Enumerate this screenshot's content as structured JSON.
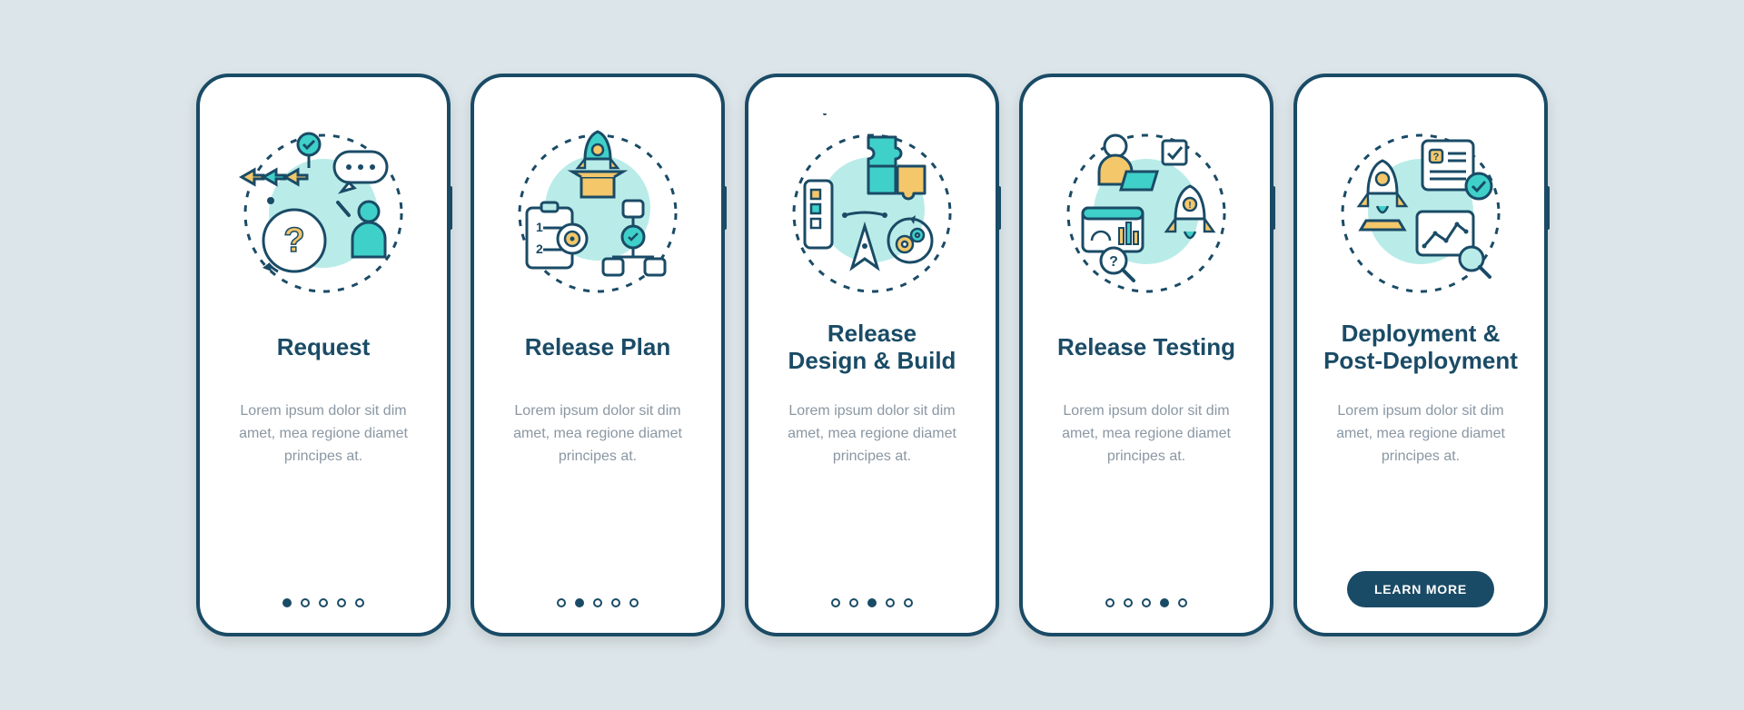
{
  "colors": {
    "stroke": "#1a4b66",
    "teal": "#3fd0c9",
    "tealLight": "#b9ece9",
    "yellow": "#f4c76a",
    "white": "#ffffff"
  },
  "cta_label": "LEARN MORE",
  "screens": [
    {
      "title": "Request",
      "description": "Lorem ipsum dolor sit dim amet, mea regione diamet principes at.",
      "active_dot": 0,
      "has_cta": false,
      "illustration": "request"
    },
    {
      "title": "Release Plan",
      "description": "Lorem ipsum dolor sit dim amet, mea regione diamet principes at.",
      "active_dot": 1,
      "has_cta": false,
      "illustration": "plan"
    },
    {
      "title": "Release\nDesign & Build",
      "description": "Lorem ipsum dolor sit dim amet, mea regione diamet principes at.",
      "active_dot": 2,
      "has_cta": false,
      "illustration": "build"
    },
    {
      "title": "Release Testing",
      "description": "Lorem ipsum dolor sit dim amet, mea regione diamet principes at.",
      "active_dot": 3,
      "has_cta": false,
      "illustration": "testing"
    },
    {
      "title": "Deployment &\nPost-Deployment",
      "description": "Lorem ipsum dolor sit dim amet, mea regione diamet principes at.",
      "active_dot": 4,
      "has_cta": true,
      "illustration": "deploy"
    }
  ]
}
